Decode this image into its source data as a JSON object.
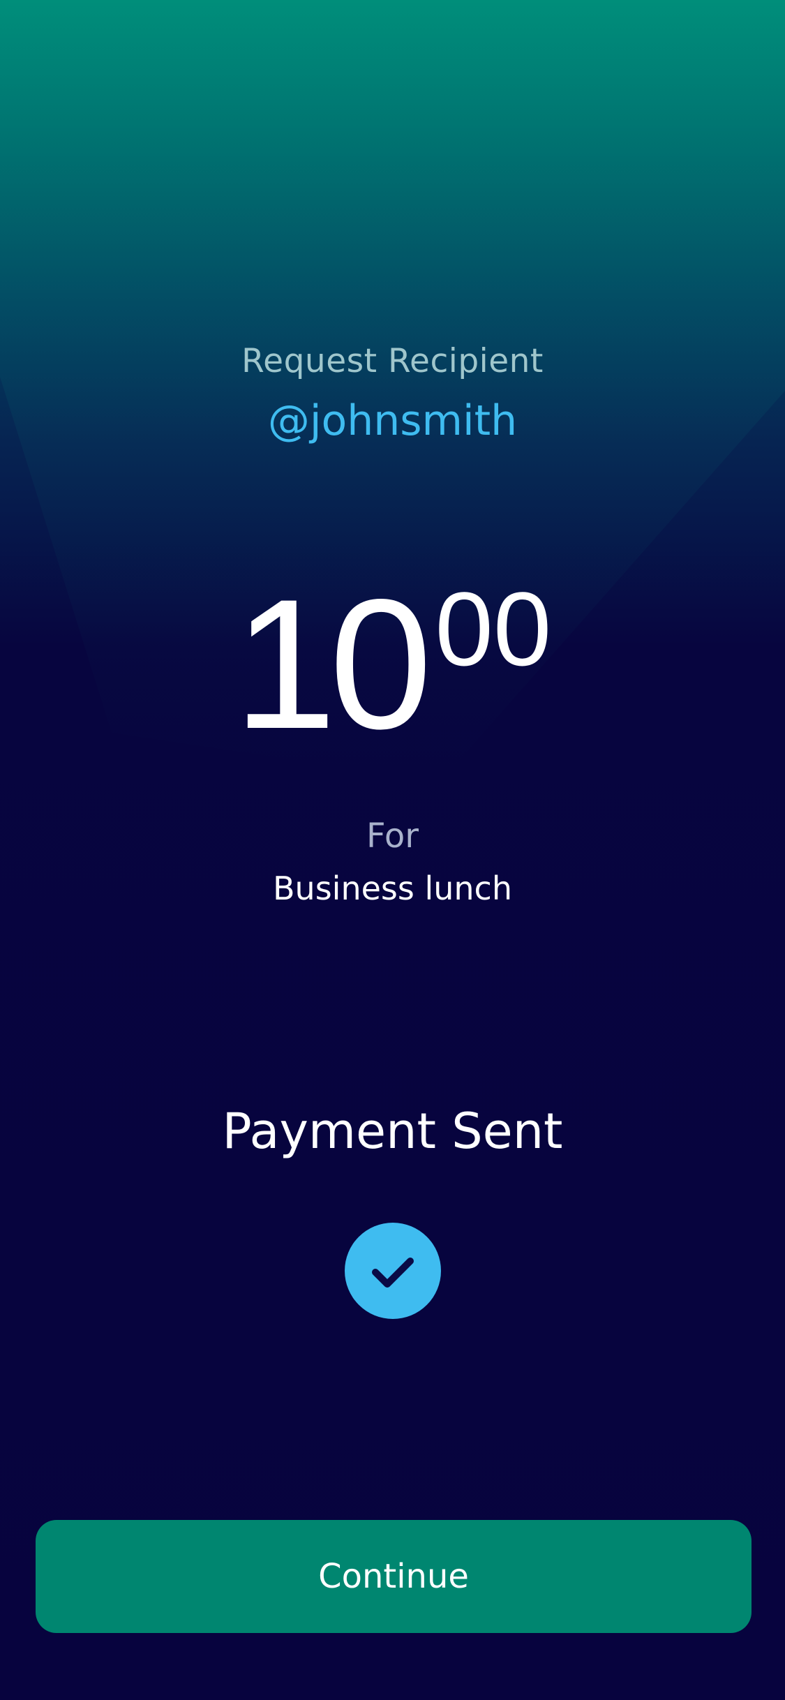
{
  "request": {
    "recipient_label": "Request Recipient",
    "recipient_handle": "@johnsmith"
  },
  "amount": {
    "whole": "10",
    "cents": "00"
  },
  "memo": {
    "label": "For",
    "value": "Business lunch"
  },
  "status": {
    "title": "Payment Sent",
    "icon": "checkmark-icon"
  },
  "actions": {
    "continue_label": "Continue"
  },
  "colors": {
    "background_top": "#008876",
    "background_bottom": "#07033e",
    "accent": "#3fbcf0",
    "button": "#008670",
    "text": "#ffffff"
  }
}
